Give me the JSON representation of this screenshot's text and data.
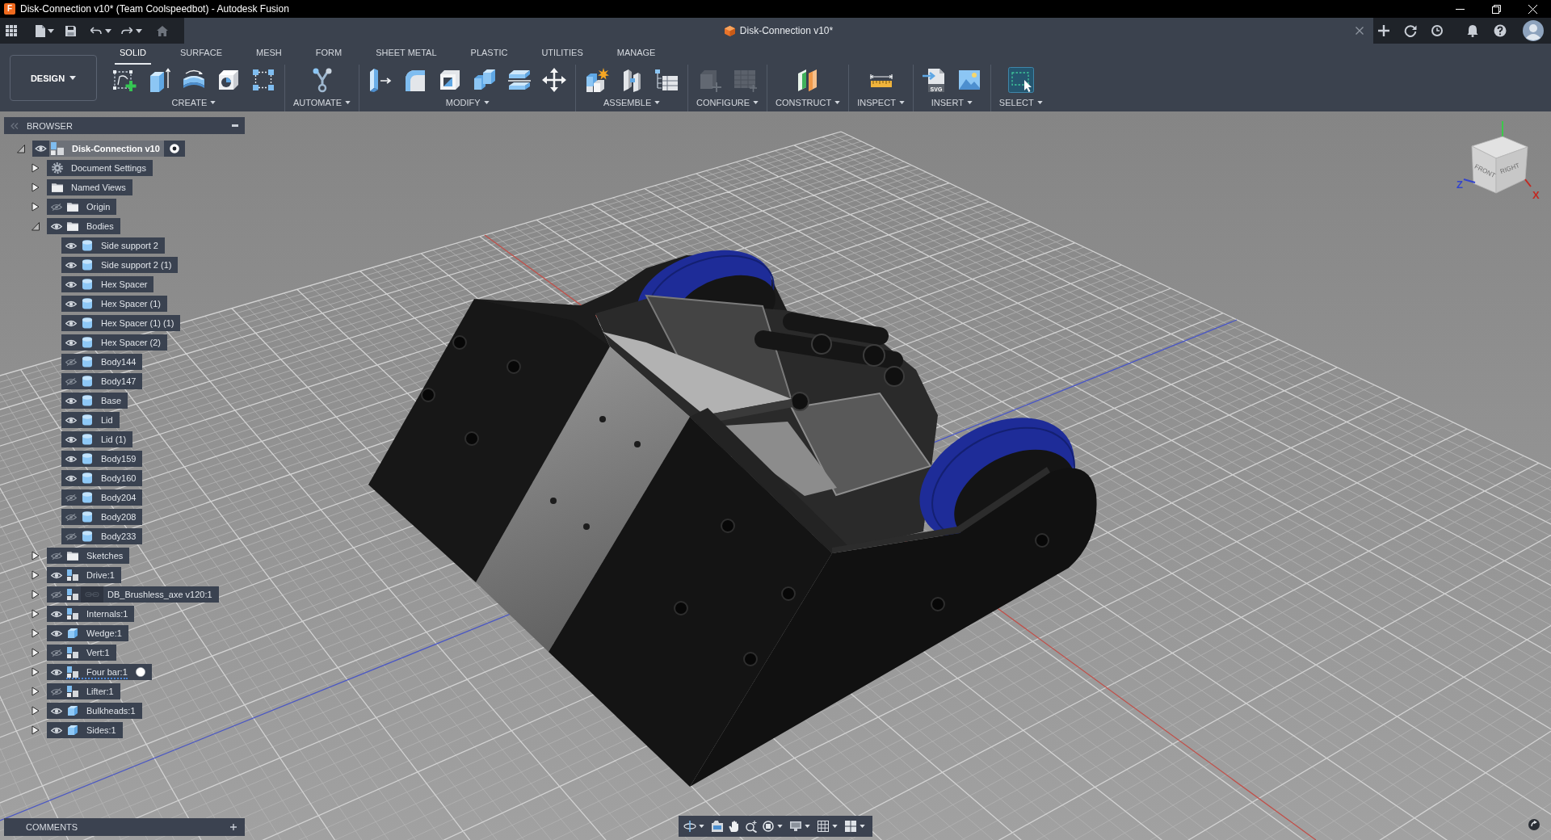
{
  "window": {
    "logo": "F",
    "title": "Disk-Connection v10* (Team Coolspeedbot) - Autodesk Fusion"
  },
  "document_tab": {
    "title": "Disk-Connection v10*"
  },
  "ribbon": {
    "workspace": "DESIGN",
    "tabs": [
      {
        "label": "SOLID",
        "selected": true
      },
      {
        "label": "SURFACE",
        "selected": false
      },
      {
        "label": "MESH",
        "selected": false
      },
      {
        "label": "FORM",
        "selected": false
      },
      {
        "label": "SHEET METAL",
        "selected": false
      },
      {
        "label": "PLASTIC",
        "selected": false
      },
      {
        "label": "UTILITIES",
        "selected": false
      },
      {
        "label": "MANAGE",
        "selected": false
      }
    ],
    "groups": [
      {
        "label": "CREATE",
        "tools": [
          {
            "kind": "sketch",
            "selected": false,
            "disabled": false
          },
          {
            "kind": "extrude",
            "selected": false,
            "disabled": false
          },
          {
            "kind": "revolve",
            "selected": false,
            "disabled": false
          },
          {
            "kind": "hole",
            "selected": false,
            "disabled": false
          },
          {
            "kind": "pattern",
            "selected": false,
            "disabled": false
          }
        ]
      },
      {
        "label": "AUTOMATE",
        "tools": [
          {
            "kind": "automate",
            "selected": false,
            "disabled": false
          }
        ]
      },
      {
        "label": "MODIFY",
        "tools": [
          {
            "kind": "press-pull",
            "selected": false,
            "disabled": false
          },
          {
            "kind": "fillet",
            "selected": false,
            "disabled": false
          },
          {
            "kind": "shell",
            "selected": false,
            "disabled": false
          },
          {
            "kind": "combine",
            "selected": false,
            "disabled": false
          },
          {
            "kind": "split",
            "selected": false,
            "disabled": false
          },
          {
            "kind": "move",
            "selected": false,
            "disabled": false
          }
        ]
      },
      {
        "label": "ASSEMBLE",
        "tools": [
          {
            "kind": "new-component",
            "selected": false,
            "disabled": false
          },
          {
            "kind": "joint",
            "selected": false,
            "disabled": false
          },
          {
            "kind": "bom-table",
            "selected": false,
            "disabled": false
          }
        ]
      },
      {
        "label": "CONFIGURE",
        "tools": [
          {
            "kind": "configure",
            "selected": false,
            "disabled": true
          },
          {
            "kind": "config-table",
            "selected": false,
            "disabled": true
          }
        ]
      },
      {
        "label": "CONSTRUCT",
        "tools": [
          {
            "kind": "plane",
            "selected": false,
            "disabled": false
          }
        ]
      },
      {
        "label": "INSPECT",
        "tools": [
          {
            "kind": "measure",
            "selected": false,
            "disabled": false
          }
        ]
      },
      {
        "label": "INSERT",
        "tools": [
          {
            "kind": "insert-svg",
            "badge": "SVG",
            "selected": false,
            "disabled": false
          },
          {
            "kind": "insert-image",
            "selected": false,
            "disabled": false
          }
        ]
      },
      {
        "label": "SELECT",
        "tools": [
          {
            "kind": "select",
            "selected": true,
            "disabled": false
          }
        ]
      }
    ]
  },
  "browser": {
    "title": "BROWSER",
    "tree": [
      {
        "kind": "document",
        "label": "Disk-Connection v10",
        "visible": true,
        "expanded": true,
        "radio_selected": true,
        "children": [
          {
            "kind": "settings",
            "label": "Document Settings",
            "expanded": false
          },
          {
            "kind": "folder",
            "label": "Named Views",
            "expanded": false
          },
          {
            "kind": "folder",
            "label": "Origin",
            "visible": false,
            "expanded": false
          },
          {
            "kind": "folder",
            "label": "Bodies",
            "visible": true,
            "expanded": true,
            "children": [
              {
                "kind": "body",
                "label": "Side support 2",
                "visible": true
              },
              {
                "kind": "body",
                "label": "Side support 2 (1)",
                "visible": true
              },
              {
                "kind": "body",
                "label": "Hex Spacer",
                "visible": true
              },
              {
                "kind": "body",
                "label": "Hex Spacer (1)",
                "visible": true
              },
              {
                "kind": "body",
                "label": "Hex Spacer (1) (1)",
                "visible": true
              },
              {
                "kind": "body",
                "label": "Hex Spacer (2)",
                "visible": true
              },
              {
                "kind": "body",
                "label": "Body144",
                "visible": false
              },
              {
                "kind": "body",
                "label": "Body147",
                "visible": false
              },
              {
                "kind": "body",
                "label": "Base",
                "visible": true
              },
              {
                "kind": "body",
                "label": "Lid",
                "visible": true
              },
              {
                "kind": "body",
                "label": "Lid (1)",
                "visible": true
              },
              {
                "kind": "body",
                "label": "Body159",
                "visible": true
              },
              {
                "kind": "body",
                "label": "Body160",
                "visible": true
              },
              {
                "kind": "body",
                "label": "Body204",
                "visible": false
              },
              {
                "kind": "body",
                "label": "Body208",
                "visible": false
              },
              {
                "kind": "body",
                "label": "Body233",
                "visible": false
              }
            ]
          },
          {
            "kind": "folder",
            "label": "Sketches",
            "visible": false,
            "expanded": false
          },
          {
            "kind": "component",
            "label": "Drive:1",
            "visible": true,
            "expanded": false
          },
          {
            "kind": "component",
            "label": "DB_Brushless_axe v120:1",
            "visible": false,
            "expanded": false,
            "linked": true
          },
          {
            "kind": "component",
            "label": "Internals:1",
            "visible": true,
            "expanded": false
          },
          {
            "kind": "body-component",
            "label": "Wedge:1",
            "visible": true,
            "expanded": false
          },
          {
            "kind": "component",
            "label": "Vert:1",
            "visible": false,
            "expanded": false
          },
          {
            "kind": "component",
            "label": "Four bar:1",
            "visible": true,
            "expanded": false,
            "radio_selected": false,
            "underlined": true
          },
          {
            "kind": "component",
            "label": "Lifter:1",
            "visible": false,
            "expanded": false
          },
          {
            "kind": "body-component",
            "label": "Bulkheads:1",
            "visible": true,
            "expanded": false
          },
          {
            "kind": "body-component",
            "label": "Sides:1",
            "visible": true,
            "expanded": false
          }
        ]
      }
    ]
  },
  "viewport": {
    "view_cube": {
      "faces": [
        {
          "label": "FRONT"
        },
        {
          "label": "RIGHT"
        }
      ],
      "axes": [
        {
          "label": "Z",
          "color": "#3344cc"
        },
        {
          "label": "X",
          "color": "#c22a22"
        }
      ]
    }
  },
  "comments": {
    "title": "COMMENTS"
  }
}
